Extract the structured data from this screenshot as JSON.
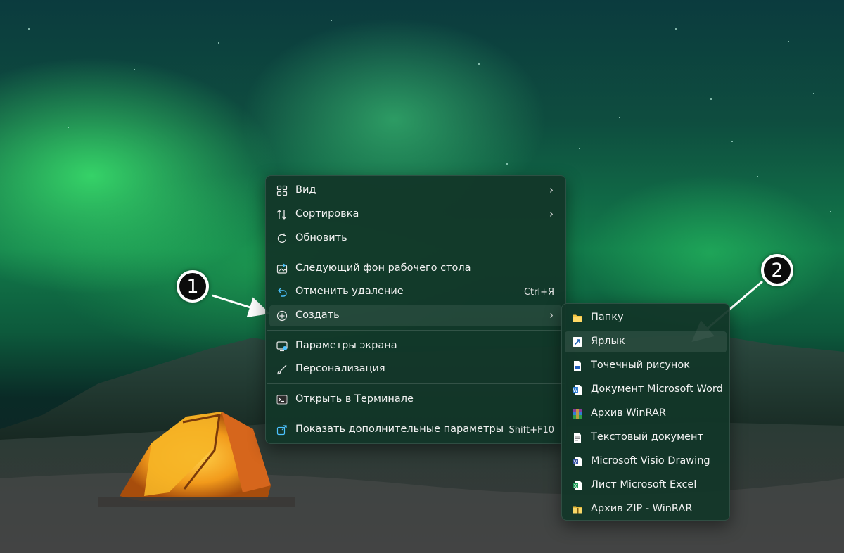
{
  "context_menu": {
    "items": [
      {
        "label": "Вид",
        "icon": "grid-icon",
        "submenu": true
      },
      {
        "label": "Сортировка",
        "icon": "sort-arrows-icon",
        "submenu": true
      },
      {
        "label": "Обновить",
        "icon": "refresh-icon"
      },
      {
        "label": "Следующий фон рабочего стола",
        "icon": "next-background-icon"
      },
      {
        "label": "Отменить удаление",
        "icon": "undo-icon",
        "shortcut": "Ctrl+Я"
      },
      {
        "label": "Создать",
        "icon": "plus-circle-icon",
        "submenu": true,
        "highlighted": true
      },
      {
        "label": "Параметры экрана",
        "icon": "display-settings-icon"
      },
      {
        "label": "Персонализация",
        "icon": "brush-icon"
      },
      {
        "label": "Открыть в Терминале",
        "icon": "terminal-icon"
      },
      {
        "label": "Показать дополнительные параметры",
        "icon": "more-options-icon",
        "shortcut": "Shift+F10"
      }
    ]
  },
  "submenu": {
    "items": [
      {
        "label": "Папку",
        "icon": "folder-icon"
      },
      {
        "label": "Ярлык",
        "icon": "shortcut-icon",
        "highlighted": true
      },
      {
        "label": "Точечный рисунок",
        "icon": "bitmap-icon"
      },
      {
        "label": "Документ Microsoft Word",
        "icon": "word-icon"
      },
      {
        "label": "Архив WinRAR",
        "icon": "winrar-icon"
      },
      {
        "label": "Текстовый документ",
        "icon": "text-document-icon"
      },
      {
        "label": "Microsoft Visio Drawing",
        "icon": "visio-icon"
      },
      {
        "label": "Лист Microsoft Excel",
        "icon": "excel-icon"
      },
      {
        "label": "Архив ZIP - WinRAR",
        "icon": "zip-icon"
      }
    ]
  },
  "annotations": {
    "badge_1": "1",
    "badge_2": "2"
  },
  "colors": {
    "menu_bg": "#123628",
    "accent": "#4cc2ff",
    "folder": "#f4c542",
    "word": "#2b7cd3",
    "excel": "#1f9b57"
  }
}
